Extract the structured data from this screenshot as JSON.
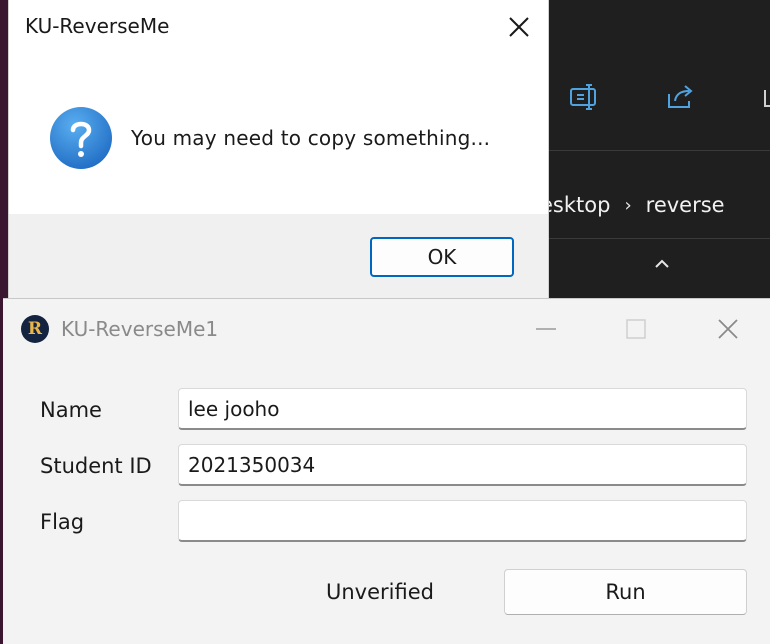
{
  "background": {
    "breadcrumb": [
      "esktop",
      "reverse"
    ]
  },
  "message_box": {
    "title": "KU-ReverseMe",
    "icon": "question-icon",
    "message": "You may need to copy something...",
    "ok_label": "OK",
    "accent": "#0067c0"
  },
  "app_window": {
    "title": "KU-ReverseMe1",
    "icon_letter": "R",
    "name_label": "Name",
    "name_value": "lee jooho",
    "student_id_label": "Student ID",
    "student_id_value": "2021350034",
    "flag_label": "Flag",
    "flag_value": "",
    "status": "Unverified",
    "run_label": "Run"
  }
}
